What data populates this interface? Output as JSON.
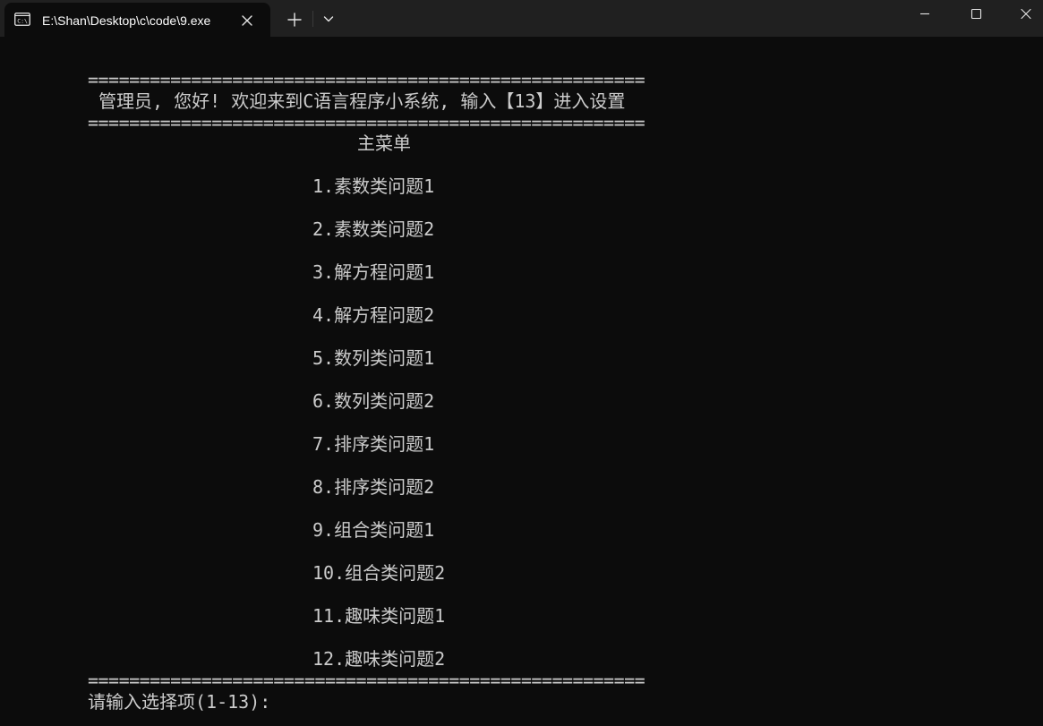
{
  "window": {
    "tab_title": "E:\\Shan\\Desktop\\c\\code\\9.exe",
    "icons": {
      "tab": "terminal-icon",
      "tab_close": "close-icon",
      "new_tab": "plus-icon",
      "dropdown": "chevron-down-icon",
      "minimize": "minimize-icon",
      "maximize": "maximize-icon",
      "close": "close-icon"
    }
  },
  "console": {
    "rule": "======================================================",
    "welcome": " 管理员, 您好! 欢迎来到C语言程序小系统, 输入【13】进入设置",
    "menu_title": "主菜单",
    "menu_items": [
      "1.素数类问题1",
      "2.素数类问题2",
      "3.解方程问题1",
      "4.解方程问题2",
      "5.数列类问题1",
      "6.数列类问题2",
      "7.排序类问题1",
      "8.排序类问题2",
      "9.组合类问题1",
      "10.组合类问题2",
      "11.趣味类问题1",
      "12.趣味类问题2"
    ],
    "prompt": "请输入选择项(1-13):"
  },
  "colors": {
    "background": "#0c0c0c",
    "titlebar": "#202020",
    "text": "#cccccc",
    "tab_text": "#ffffff"
  }
}
